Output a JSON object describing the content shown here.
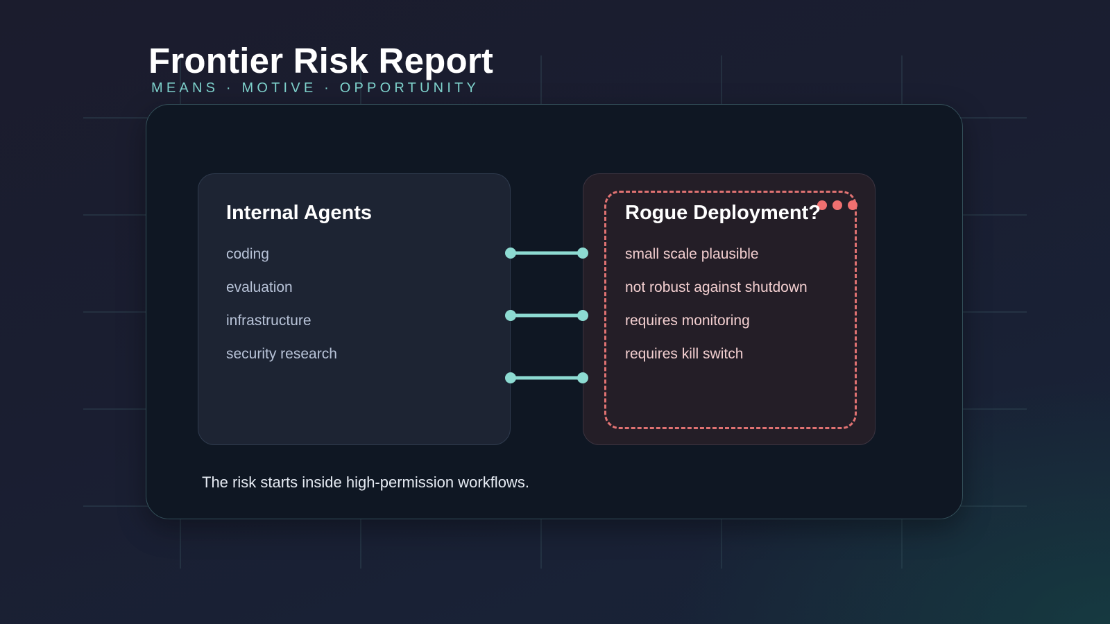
{
  "header": {
    "title": "Frontier Risk Report",
    "subtitle": "MEANS · MOTIVE · OPPORTUNITY"
  },
  "left_card": {
    "title": "Internal Agents",
    "items": [
      "coding",
      "evaluation",
      "infrastructure",
      "security research"
    ]
  },
  "right_card": {
    "title": "Rogue Deployment?",
    "items": [
      "small scale plausible",
      "not robust against shutdown",
      "requires monitoring",
      "requires kill switch"
    ]
  },
  "connectors": {
    "count": 3
  },
  "caption": "The risk starts inside high-permission workflows.",
  "colors": {
    "accent_teal": "#8ddbd2",
    "alert_red": "#e07272",
    "subtitle_teal": "#7fd3cd",
    "panel_bg": "#0f1723"
  },
  "icons": {
    "alert": "alert-dots-icon",
    "connector": "connector-line-icon"
  }
}
